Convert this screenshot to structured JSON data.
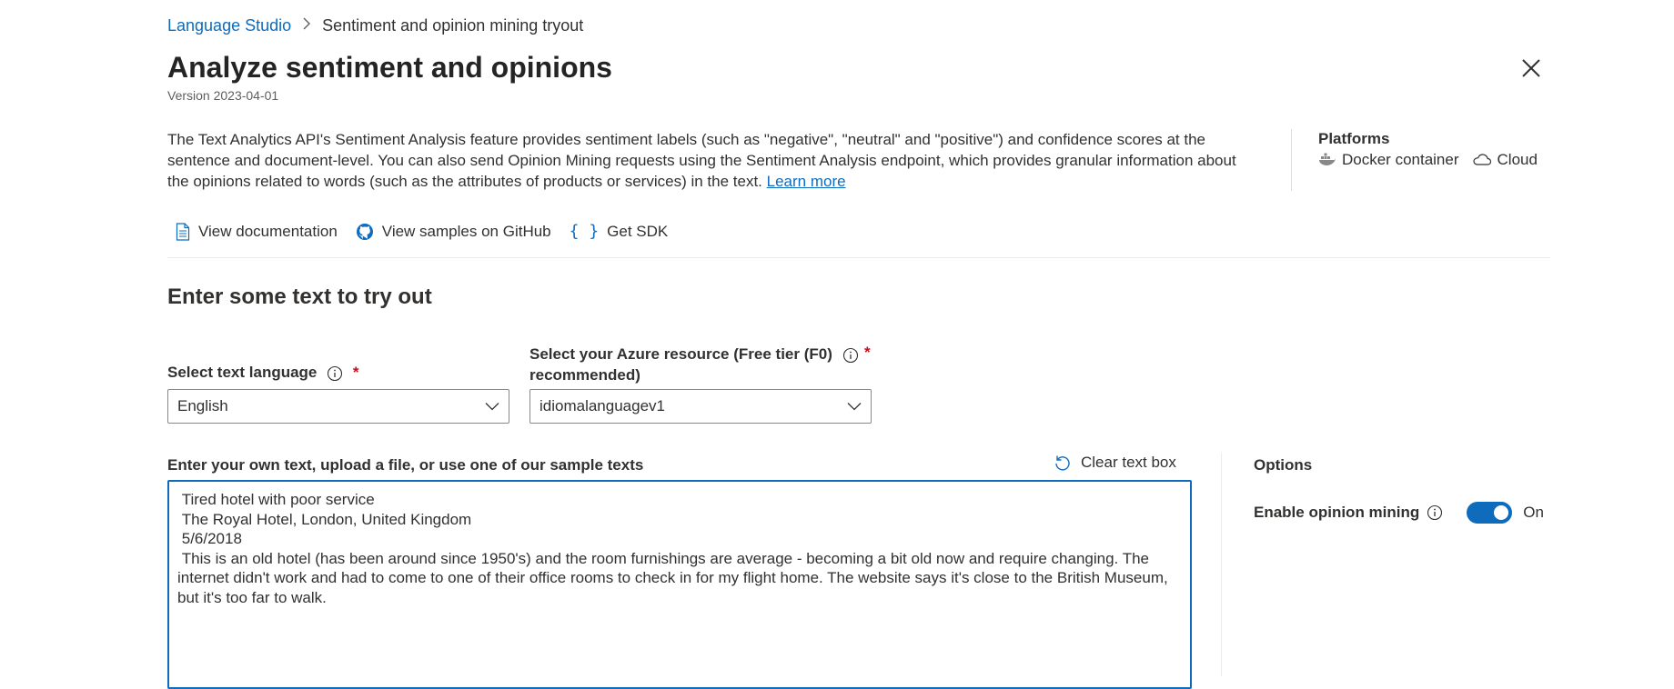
{
  "breadcrumb": {
    "root": "Language Studio",
    "current": "Sentiment and opinion mining tryout"
  },
  "header": {
    "title": "Analyze sentiment and opinions",
    "version": "Version 2023-04-01",
    "close_icon": "close-icon"
  },
  "description": {
    "text": "The Text Analytics API's Sentiment Analysis feature provides sentiment labels (such as \"negative\", \"neutral\" and \"positive\") and confidence scores at the sentence and document-level. You can also send Opinion Mining requests using the Sentiment Analysis endpoint, which provides granular information about the opinions related to words (such as the attributes of products or services) in the text.",
    "link": "Learn more"
  },
  "platforms": {
    "title": "Platforms",
    "items": [
      {
        "label": "Docker container",
        "icon": "docker-icon"
      },
      {
        "label": "Cloud",
        "icon": "cloud-icon"
      }
    ]
  },
  "links": [
    {
      "label": "View documentation",
      "icon": "document-icon"
    },
    {
      "label": "View samples on GitHub",
      "icon": "github-icon"
    },
    {
      "label": "Get SDK",
      "icon": "braces-icon"
    }
  ],
  "section": {
    "title": "Enter some text to try out"
  },
  "language": {
    "label": "Select text language",
    "required": "*",
    "value": "English"
  },
  "resource": {
    "label": "Select your Azure resource (Free tier (F0) recommended)",
    "required": "*",
    "value": "idiomalanguagev1"
  },
  "input": {
    "label": "Enter your own text, upload a file, or use one of our sample texts",
    "clear_label": "Clear text box",
    "value": " Tired hotel with poor service\n The Royal Hotel, London, United Kingdom\n 5/6/2018\n This is an old hotel (has been around since 1950's) and the room furnishings are average - becoming a bit old now and require changing. The internet didn't work and had to come to one of their office rooms to check in for my flight home. The website says it's close to the British Museum, but it's too far to walk."
  },
  "options": {
    "title": "Options",
    "opinion_mining_label": "Enable opinion mining",
    "toggle_state": "On"
  },
  "colors": {
    "accent": "#0f6cbd",
    "required": "#c50f1f"
  }
}
